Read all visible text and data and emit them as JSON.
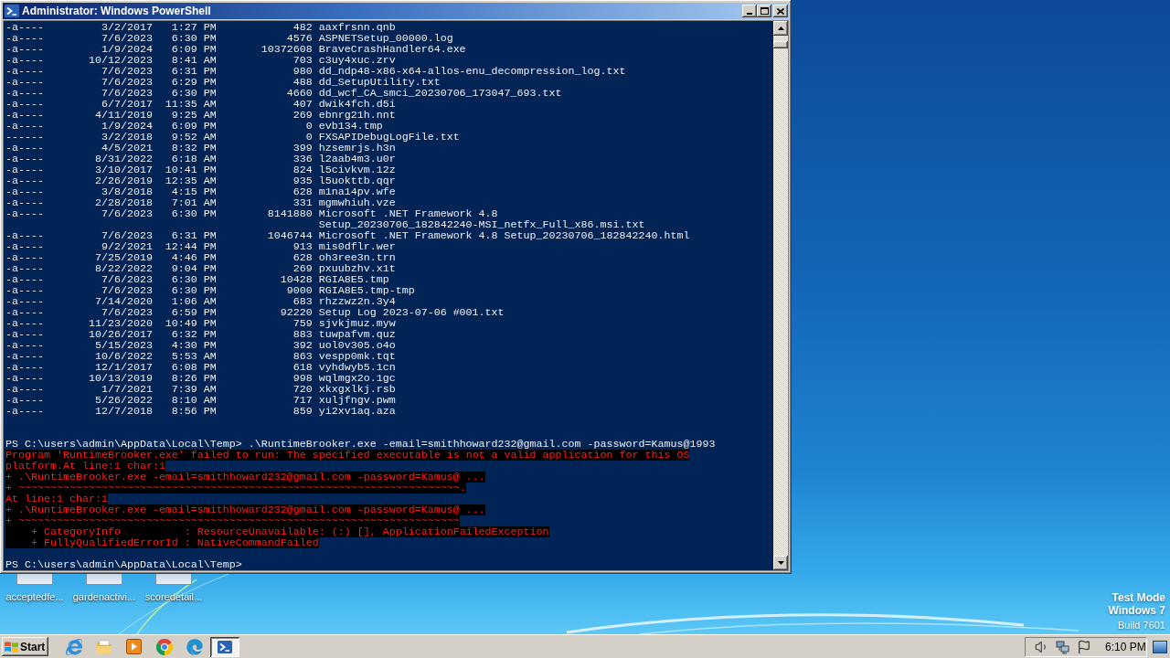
{
  "window": {
    "title": "Administrator: Windows PowerShell"
  },
  "console": {
    "listing": [
      {
        "mode": "-a----",
        "date": "3/2/2017",
        "time": "1:27 PM",
        "length": "482",
        "name": "aaxfrsnn.qnb"
      },
      {
        "mode": "-a----",
        "date": "7/6/2023",
        "time": "6:30 PM",
        "length": "4576",
        "name": "ASPNETSetup_00000.log"
      },
      {
        "mode": "-a----",
        "date": "1/9/2024",
        "time": "6:09 PM",
        "length": "10372608",
        "name": "BraveCrashHandler64.exe"
      },
      {
        "mode": "-a----",
        "date": "10/12/2023",
        "time": "8:41 AM",
        "length": "703",
        "name": "c3uy4xuc.zrv"
      },
      {
        "mode": "-a----",
        "date": "7/6/2023",
        "time": "6:31 PM",
        "length": "980",
        "name": "dd_ndp48-x86-x64-allos-enu_decompression_log.txt"
      },
      {
        "mode": "-a----",
        "date": "7/6/2023",
        "time": "6:29 PM",
        "length": "488",
        "name": "dd_SetupUtility.txt"
      },
      {
        "mode": "-a----",
        "date": "7/6/2023",
        "time": "6:30 PM",
        "length": "4660",
        "name": "dd_wcf_CA_smci_20230706_173047_693.txt"
      },
      {
        "mode": "-a----",
        "date": "6/7/2017",
        "time": "11:35 AM",
        "length": "407",
        "name": "dwik4fch.d5i"
      },
      {
        "mode": "-a----",
        "date": "4/11/2019",
        "time": "9:25 AM",
        "length": "269",
        "name": "ebnrg21h.nnt"
      },
      {
        "mode": "-a----",
        "date": "1/9/2024",
        "time": "6:09 PM",
        "length": "0",
        "name": "evb134.tmp"
      },
      {
        "mode": "------",
        "date": "3/2/2018",
        "time": "9:52 AM",
        "length": "0",
        "name": "FXSAPIDebugLogFile.txt"
      },
      {
        "mode": "-a----",
        "date": "4/5/2021",
        "time": "8:32 PM",
        "length": "399",
        "name": "hzsemrjs.h3n"
      },
      {
        "mode": "-a----",
        "date": "8/31/2022",
        "time": "6:18 AM",
        "length": "336",
        "name": "l2aab4m3.u0r"
      },
      {
        "mode": "-a----",
        "date": "3/10/2017",
        "time": "10:41 PM",
        "length": "824",
        "name": "l5civkvm.12z"
      },
      {
        "mode": "-a----",
        "date": "2/26/2019",
        "time": "12:35 AM",
        "length": "935",
        "name": "l5uokttb.qqr"
      },
      {
        "mode": "-a----",
        "date": "3/8/2018",
        "time": "4:15 PM",
        "length": "628",
        "name": "m1na14pv.wfe"
      },
      {
        "mode": "-a----",
        "date": "2/28/2018",
        "time": "7:01 AM",
        "length": "331",
        "name": "mgmwhiuh.vze"
      },
      {
        "mode": "-a----",
        "date": "7/6/2023",
        "time": "6:30 PM",
        "length": "8141880",
        "name_lines": [
          "Microsoft .NET Framework 4.8",
          "Setup_20230706_182842240-MSI_netfx_Full_x86.msi.txt"
        ]
      },
      {
        "mode": "-a----",
        "date": "7/6/2023",
        "time": "6:31 PM",
        "length": "1046744",
        "name": "Microsoft .NET Framework 4.8 Setup_20230706_182842240.html"
      },
      {
        "mode": "-a----",
        "date": "9/2/2021",
        "time": "12:44 PM",
        "length": "913",
        "name": "mis0dflr.wer"
      },
      {
        "mode": "-a----",
        "date": "7/25/2019",
        "time": "4:46 PM",
        "length": "628",
        "name": "oh3ree3n.trn"
      },
      {
        "mode": "-a----",
        "date": "8/22/2022",
        "time": "9:04 PM",
        "length": "269",
        "name": "pxuubzhv.x1t"
      },
      {
        "mode": "-a----",
        "date": "7/6/2023",
        "time": "6:30 PM",
        "length": "10428",
        "name": "RGIA8E5.tmp"
      },
      {
        "mode": "-a----",
        "date": "7/6/2023",
        "time": "6:30 PM",
        "length": "9000",
        "name": "RGIA8E5.tmp-tmp"
      },
      {
        "mode": "-a----",
        "date": "7/14/2020",
        "time": "1:06 AM",
        "length": "683",
        "name": "rhzzwz2n.3y4"
      },
      {
        "mode": "-a----",
        "date": "7/6/2023",
        "time": "6:59 PM",
        "length": "92220",
        "name": "Setup Log 2023-07-06 #001.txt"
      },
      {
        "mode": "-a----",
        "date": "11/23/2020",
        "time": "10:49 PM",
        "length": "759",
        "name": "sjvkjmuz.myw"
      },
      {
        "mode": "-a----",
        "date": "10/26/2017",
        "time": "6:32 PM",
        "length": "883",
        "name": "tuwpafvm.quz"
      },
      {
        "mode": "-a----",
        "date": "5/15/2023",
        "time": "4:30 PM",
        "length": "392",
        "name": "uol0v305.o4o"
      },
      {
        "mode": "-a----",
        "date": "10/6/2022",
        "time": "5:53 AM",
        "length": "863",
        "name": "vespp0mk.tqt"
      },
      {
        "mode": "-a----",
        "date": "12/1/2017",
        "time": "6:08 PM",
        "length": "618",
        "name": "vyhdwyb5.1cn"
      },
      {
        "mode": "-a----",
        "date": "10/13/2019",
        "time": "8:26 PM",
        "length": "998",
        "name": "wqlmgx2o.1gc"
      },
      {
        "mode": "-a----",
        "date": "1/7/2021",
        "time": "7:39 AM",
        "length": "720",
        "name": "xkxgxlkj.rsb"
      },
      {
        "mode": "-a----",
        "date": "5/26/2022",
        "time": "8:10 AM",
        "length": "717",
        "name": "xuljfngv.pwm"
      },
      {
        "mode": "-a----",
        "date": "12/7/2018",
        "time": "8:56 PM",
        "length": "859",
        "name": "yi2xv1aq.aza"
      }
    ],
    "lines": [
      {
        "kind": "blank"
      },
      {
        "kind": "blank"
      },
      {
        "kind": "command",
        "prompt": "PS C:\\users\\admin\\AppData\\Local\\Temp>",
        "command": ".\\RuntimeBrooker.exe -email=smithhoward232@gmail.com -password=Kamus@1993"
      },
      {
        "kind": "error",
        "text": "Program 'RuntimeBrooker.exe' failed to run: The specified executable is not a valid application for this OS"
      },
      {
        "kind": "error",
        "text": "platform.At line:1 char:1"
      },
      {
        "kind": "error",
        "text": "+ .\\RuntimeBrooker.exe -email=smithhoward232@gmail.com -password=Kamus@ ..."
      },
      {
        "kind": "error",
        "text": "+ ~~~~~~~~~~~~~~~~~~~~~~~~~~~~~~~~~~~~~~~~~~~~~~~~~~~~~~~~~~~~~~~~~~~~~."
      },
      {
        "kind": "error",
        "text": "At line:1 char:1"
      },
      {
        "kind": "error",
        "text": "+ .\\RuntimeBrooker.exe -email=smithhoward232@gmail.com -password=Kamus@ ..."
      },
      {
        "kind": "error",
        "text": "+ ~~~~~~~~~~~~~~~~~~~~~~~~~~~~~~~~~~~~~~~~~~~~~~~~~~~~~~~~~~~~~~~~~~~~~"
      },
      {
        "kind": "error",
        "text": "    + CategoryInfo          : ResourceUnavailable: (:) [], ApplicationFailedException"
      },
      {
        "kind": "error",
        "text": "    + FullyQualifiedErrorId : NativeCommandFailed"
      },
      {
        "kind": "blank"
      },
      {
        "kind": "prompt",
        "prompt": "PS C:\\users\\admin\\AppData\\Local\\Temp>"
      }
    ]
  },
  "desktop": {
    "icons": [
      {
        "label": "acceptedfe..."
      },
      {
        "label": "gardenactivi..."
      },
      {
        "label": "scoredetail..."
      }
    ],
    "os_notice": [
      {
        "text": "Test Mode",
        "kind": "heading"
      },
      {
        "text": "Windows 7",
        "kind": "heading"
      },
      {
        "text": "Build 7601",
        "kind": "detail"
      }
    ]
  },
  "taskbar": {
    "start_label": "Start",
    "window_buttons": [
      {
        "kind": "powershell",
        "selected": true
      }
    ],
    "clock": "6:10 PM"
  }
}
